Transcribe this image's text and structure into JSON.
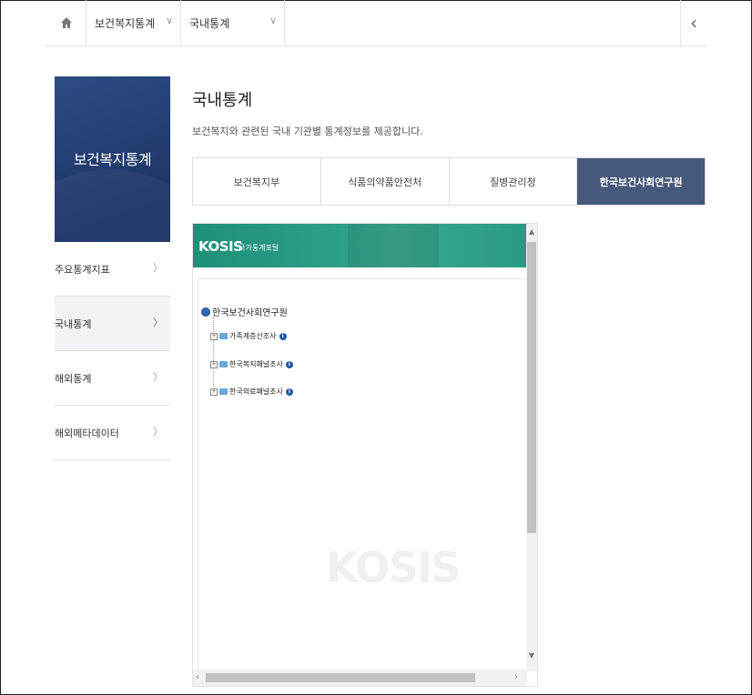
{
  "breadcrumb": {
    "level1": "보건복지통계",
    "level2": "국내통계"
  },
  "sidebar": {
    "title": "보건복지통계",
    "items": [
      {
        "label": "주요통계지표"
      },
      {
        "label": "국내통계"
      },
      {
        "label": "해외통계"
      },
      {
        "label": "해외메타데이터"
      }
    ]
  },
  "main": {
    "title": "국내통계",
    "description": "보건복지와 관련된 국내 기관별 통계정보를 제공합니다.",
    "tabs": [
      {
        "label": "보건복지부"
      },
      {
        "label": "식품의약품안전처"
      },
      {
        "label": "질병관리청"
      },
      {
        "label": "한국보건사회연구원"
      }
    ]
  },
  "kosis": {
    "logo": "KOSIS",
    "subtitle": "국가통계포털",
    "watermark": "KOSIS",
    "tree": {
      "root": "한국보건사회연구원",
      "items": [
        {
          "label": "가족계층산조사"
        },
        {
          "label": "한국복지패널조사"
        },
        {
          "label": "한국의료패널조사"
        }
      ]
    }
  },
  "colors": {
    "sidebar_banner": "#233f73",
    "active_tab": "#47597a",
    "kosis_bar": "#2a9a84"
  }
}
